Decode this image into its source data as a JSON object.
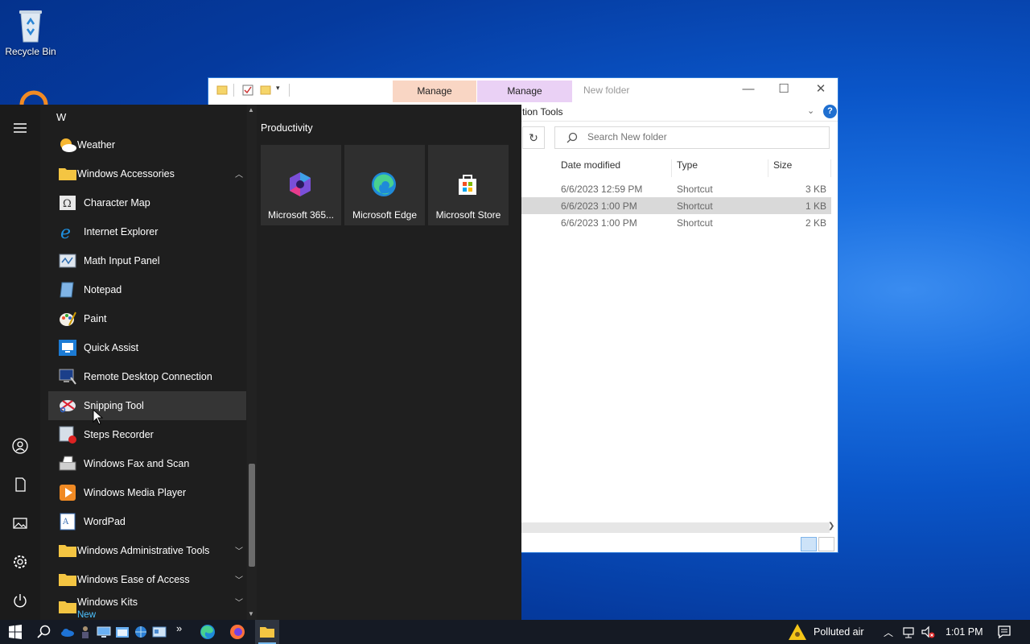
{
  "desktop": {
    "recycle_bin_label": "Recycle Bin"
  },
  "explorer": {
    "title": "New folder",
    "ribbon": {
      "manage_tab_1": "Manage",
      "manage_tab_2": "Manage",
      "sub_label": "tion Tools"
    },
    "search": {
      "placeholder": "Search New folder"
    },
    "columns": [
      "Date modified",
      "Type",
      "Size"
    ],
    "rows": [
      {
        "date": "6/6/2023 12:59 PM",
        "type": "Shortcut",
        "size": "3 KB",
        "selected": false
      },
      {
        "date": "6/6/2023 1:00 PM",
        "type": "Shortcut",
        "size": "1 KB",
        "selected": true
      },
      {
        "date": "6/6/2023 1:00 PM",
        "type": "Shortcut",
        "size": "2 KB",
        "selected": false
      }
    ]
  },
  "start_menu": {
    "letter_header": "W",
    "apps": {
      "weather": "Weather",
      "windows_accessories": "Windows Accessories",
      "character_map": "Character Map",
      "internet_explorer": "Internet Explorer",
      "math_input_panel": "Math Input Panel",
      "notepad": "Notepad",
      "paint": "Paint",
      "quick_assist": "Quick Assist",
      "remote_desktop": "Remote Desktop Connection",
      "snipping_tool": "Snipping Tool",
      "steps_recorder": "Steps Recorder",
      "fax_and_scan": "Windows Fax and Scan",
      "media_player": "Windows Media Player",
      "wordpad": "WordPad",
      "admin_tools": "Windows Administrative Tools",
      "ease_of_access": "Windows Ease of Access",
      "windows_kits": "Windows Kits",
      "windows_kits_badge": "New"
    },
    "tiles": {
      "group_label": "Productivity",
      "m365": "Microsoft 365...",
      "edge": "Microsoft Edge",
      "store": "Microsoft Store"
    }
  },
  "taskbar": {
    "weather_text": "Polluted air",
    "clock": "1:01 PM"
  },
  "colors": {
    "accent": "#0078d7",
    "start_bg": "#1f1f1f",
    "taskbar_bg": "#151a24",
    "new_badge": "#4cc2ff"
  }
}
